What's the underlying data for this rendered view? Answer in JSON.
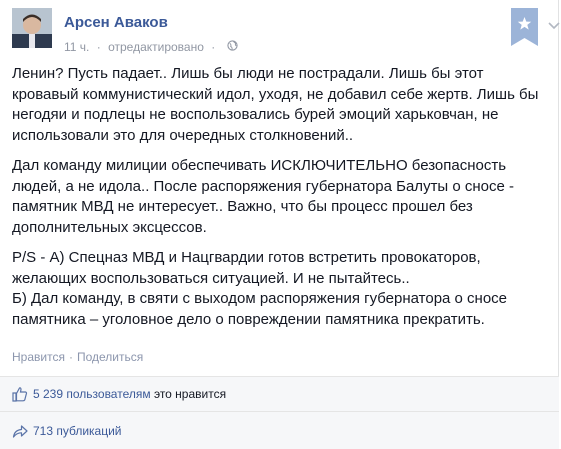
{
  "post": {
    "author": "Арсен Аваков",
    "time": "11 ч.",
    "edited": "отредактировано",
    "separator": "·",
    "paragraphs": [
      "Ленин? Пусть падает.. Лишь бы люди не пострадали. Лишь бы этот кровавый коммунистический идол, уходя, не добавил себе жертв. Лишь бы негодяи и подлецы не воспользовались бурей эмоций харьковчан, не использовали это для очередных столкновений..",
      "Дал команду милиции обеспечивать ИСКЛЮЧИТЕЛЬНО безопасность людей, а не идола.. После распоряжения губернатора Балуты о сносе - памятник МВД не интересует.. Важно, что бы процесс прошел без дополнительных эксцессов.",
      "P/S - А) Спецназ МВД и Нацгвардии готов встретить провокаторов, желающих воспользоваться ситуацией. И не пытайтесь..\nБ) Дал команду, в святи с выходом распоряжения губернатора о сносе памятника – уголовное дело о повреждении памятника прекратить."
    ]
  },
  "actions": {
    "like": "Нравится",
    "dot": "·",
    "share": "Поделиться"
  },
  "likes": {
    "count_text": "5 239 пользователям",
    "suffix": "это нравится"
  },
  "shares": {
    "text": "713 публикаций"
  },
  "colors": {
    "link": "#3b5998",
    "meta": "#9197a3",
    "bookmark": "#9cb4d8"
  },
  "icons": [
    "globe-icon",
    "bookmark-star-icon",
    "chevron-down-icon",
    "thumbs-up-icon",
    "share-arrow-icon"
  ]
}
